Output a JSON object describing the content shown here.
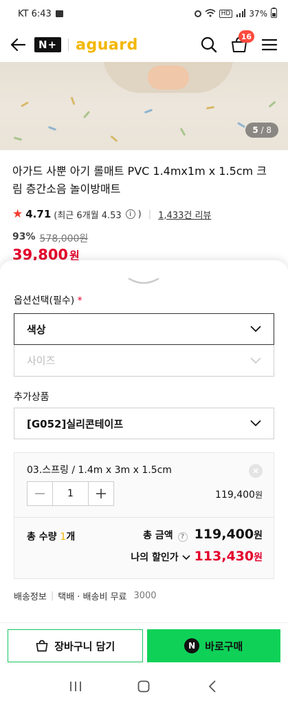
{
  "status": {
    "carrier_time": "KT 6:43",
    "battery": "37%"
  },
  "header": {
    "brand_badge": "N+",
    "brand_name": "aguard",
    "cart_count": "16"
  },
  "gallery": {
    "current": "5",
    "total": "/ 8"
  },
  "product": {
    "title": "아가드 사뿐 아기 롤매트 PVC 1.4mx1m x 1.5cm 크림 층간소음 놀이방매트",
    "rating": "4.71",
    "recent_rating": "(최근 6개월 4.53",
    "reviews": "1,433건 리뷰",
    "discount_rate": "93%",
    "original_price": "578,000원",
    "price": "39,800",
    "price_unit": "원"
  },
  "options": {
    "label": "옵션선택(필수)",
    "required_mark": "*",
    "color_select": "색상",
    "size_select": "사이즈",
    "addon_label": "추가상품",
    "addon_select": "[G052]실리콘테이프"
  },
  "selected": {
    "name": "03.스프링 / 1.4m x 3m x 1.5cm",
    "quantity": "1",
    "price": "119,400",
    "price_unit": "원"
  },
  "totals": {
    "qty_label": "총 수량",
    "qty_value": "1",
    "qty_unit": "개",
    "amount_label": "총 금액",
    "amount_value": "119,400",
    "amount_unit": "원",
    "discount_label": "나의 할인가",
    "discount_value": "113,430",
    "discount_unit": "원"
  },
  "shipping": {
    "label": "배송정보",
    "method": "택배 · 배송비 무료",
    "extra": "3000"
  },
  "actions": {
    "cart_label": "장바구니 담기",
    "buy_badge": "N",
    "buy_label": "바로구매"
  },
  "colors": {
    "accent_green": "#0fd158",
    "price_red": "#e4002b",
    "brand_yellow": "#f2b700"
  }
}
